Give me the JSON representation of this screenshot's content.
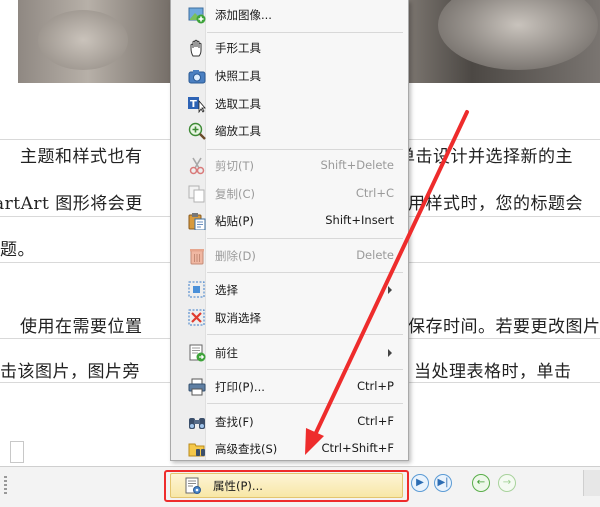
{
  "document": {
    "paragraph1": {
      "line1_left": "主题和样式也有",
      "line1_right": "单击设计并选择新的主",
      "line2_left": "artArt 图形将会更",
      "line2_right": "用样式时，您的标题会",
      "line3": "题。"
    },
    "paragraph2": {
      "line1_left": "使用在需要位置",
      "line1_right": "保存时间。若要更改图片",
      "line2_left": "击该图片，图片旁",
      "line2_right": "当处理表格时，单击"
    }
  },
  "menu": {
    "items": [
      {
        "label": "添加图像...",
        "shortcut": "",
        "icon": "add-image-icon",
        "disabled": false
      },
      {
        "label": "手形工具",
        "shortcut": "",
        "icon": "hand-tool-icon",
        "disabled": false
      },
      {
        "label": "快照工具",
        "shortcut": "",
        "icon": "camera-icon",
        "disabled": false
      },
      {
        "label": "选取工具",
        "shortcut": "",
        "icon": "text-select-icon",
        "disabled": false
      },
      {
        "label": "缩放工具",
        "shortcut": "",
        "icon": "zoom-icon",
        "disabled": false
      },
      {
        "label": "剪切(T)",
        "shortcut": "Shift+Delete",
        "icon": "scissors-icon",
        "disabled": true
      },
      {
        "label": "复制(C)",
        "shortcut": "Ctrl+C",
        "icon": "copy-icon",
        "disabled": true
      },
      {
        "label": "粘贴(P)",
        "shortcut": "Shift+Insert",
        "icon": "paste-icon",
        "disabled": false
      },
      {
        "label": "删除(D)",
        "shortcut": "Delete",
        "icon": "trash-icon",
        "disabled": true
      },
      {
        "label": "选择",
        "shortcut": "",
        "icon": "select-icon",
        "disabled": false,
        "submenu": true
      },
      {
        "label": "取消选择",
        "shortcut": "",
        "icon": "deselect-icon",
        "disabled": false
      },
      {
        "label": "前往",
        "shortcut": "",
        "icon": "goto-icon",
        "disabled": false,
        "submenu": true
      },
      {
        "label": "打印(P)...",
        "shortcut": "Ctrl+P",
        "icon": "printer-icon",
        "disabled": false
      },
      {
        "label": "查找(F)",
        "shortcut": "Ctrl+F",
        "icon": "binoculars-icon",
        "disabled": false
      },
      {
        "label": "高级查找(S)",
        "shortcut": "Ctrl+Shift+F",
        "icon": "folder-search-icon",
        "disabled": false
      },
      {
        "label": "属性(P)...",
        "shortcut": "",
        "icon": "properties-icon",
        "disabled": false,
        "highlighted": true
      }
    ]
  },
  "statusbar": {
    "nav": [
      "next-page",
      "last-page",
      "back",
      "forward"
    ],
    "nav_glyphs": [
      "▶",
      "▶|",
      "←",
      "→"
    ]
  },
  "colors": {
    "annotation_red": "#ee2c2c",
    "menu_highlight": "#f8e7a6"
  }
}
